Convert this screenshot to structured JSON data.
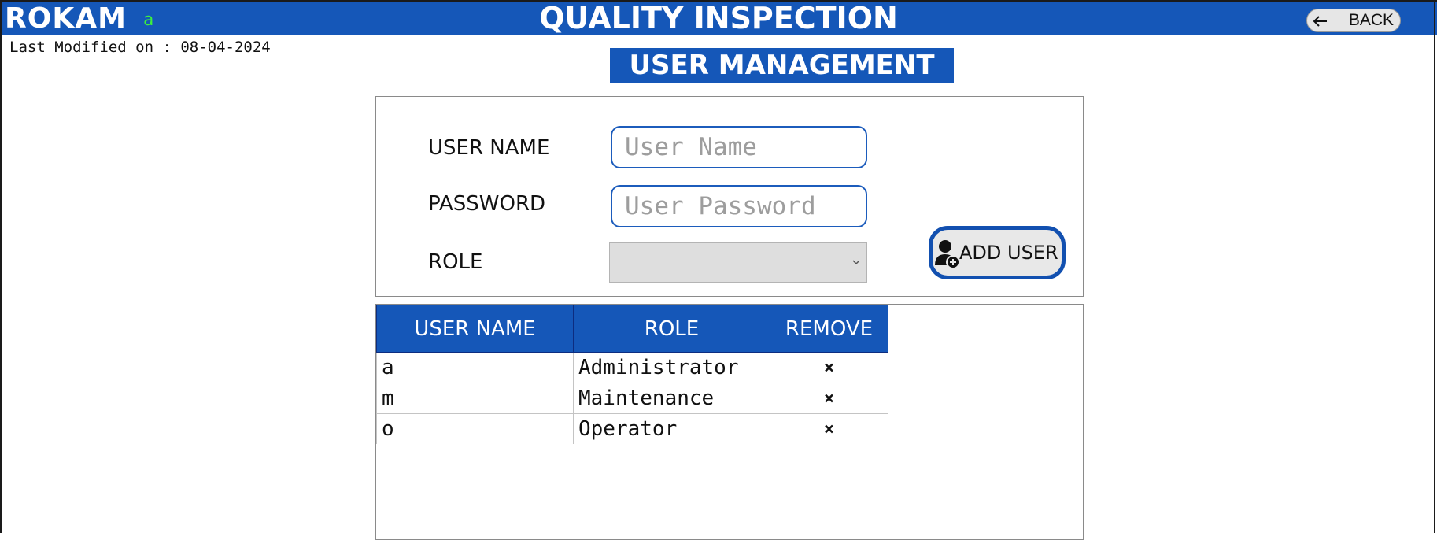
{
  "header": {
    "brand": "ROKAM",
    "current_user": "a",
    "title": "QUALITY INSPECTION",
    "back_label": "BACK",
    "back_icon": "arrow-left-icon"
  },
  "last_modified": "Last Modified on : 08-04-2024",
  "page": {
    "section_title": "USER MANAGEMENT"
  },
  "form": {
    "username_label": "USER NAME",
    "username_placeholder": "User Name",
    "username_value": "",
    "password_label": "PASSWORD",
    "password_placeholder": "User Password",
    "password_value": "",
    "role_label": "ROLE",
    "role_selected": "",
    "add_user_label": "ADD USER",
    "add_user_icon": "user-add-icon"
  },
  "table": {
    "headers": [
      "USER NAME",
      "ROLE",
      "REMOVE"
    ],
    "rows": [
      {
        "name": "a",
        "role": "Administrator",
        "remove": "×"
      },
      {
        "name": "m",
        "role": "Maintenance",
        "remove": "×"
      },
      {
        "name": "o",
        "role": "Operator",
        "remove": "×"
      }
    ]
  },
  "colors": {
    "primary": "#1557b8",
    "current_user": "#3df03d",
    "input_border": "#1c5cbc"
  }
}
